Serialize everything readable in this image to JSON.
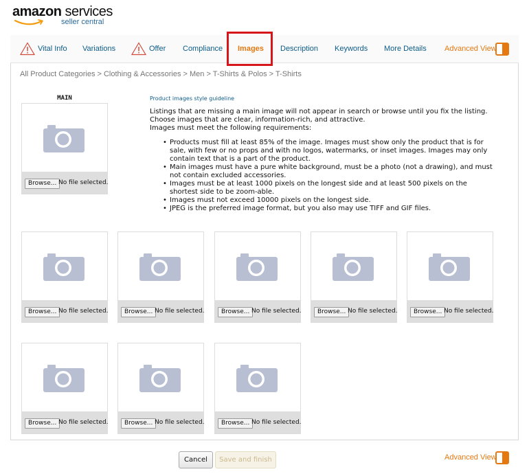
{
  "logo": {
    "brand": "amazon",
    "service": "services",
    "subtitle": "seller central"
  },
  "tabs": [
    {
      "label": "Vital Info",
      "warning": true
    },
    {
      "label": "Variations",
      "warning": false
    },
    {
      "label": "Offer",
      "warning": true
    },
    {
      "label": "Compliance",
      "warning": false
    },
    {
      "label": "Images",
      "warning": false,
      "active": true
    },
    {
      "label": "Description",
      "warning": false
    },
    {
      "label": "Keywords",
      "warning": false
    },
    {
      "label": "More Details",
      "warning": false
    }
  ],
  "advanced_view": {
    "label": "Advanced View",
    "enabled": true
  },
  "breadcrumb": "All Product Categories > Clothing & Accessories > Men > T-Shirts & Polos > T-Shirts",
  "main_image_label": "MAIN",
  "file_input": {
    "button": "Browse...",
    "status": "No file selected."
  },
  "guideline": {
    "link": "Product images style guideline",
    "intro": [
      "Listings that are missing a main image will not appear in search or browse until you fix the listing.",
      "Choose images that are clear, information-rich, and attractive.",
      "Images must meet the following requirements:"
    ],
    "requirements": [
      "Products must fill at least 85% of the image. Images must show only the product that is for sale, with few or no props and with no logos, watermarks, or inset images. Images may only contain text that is a part of the product.",
      "Main images must have a pure white background, must be a photo (not a drawing), and must not contain excluded accessories.",
      "Images must be at least 1000 pixels on the longest side and at least 500 pixels on the shortest side to be zoom-able.",
      "Images must not exceed 10000 pixels on the longest side.",
      "JPEG is the preferred image format, but you also may use TIFF and GIF files."
    ]
  },
  "buttons": {
    "cancel": "Cancel",
    "save": "Save and finish"
  },
  "colors": {
    "accent": "#e47911",
    "link": "#0d5c8a",
    "camera": "#b8bfd3",
    "highlight": "#d7161c"
  }
}
